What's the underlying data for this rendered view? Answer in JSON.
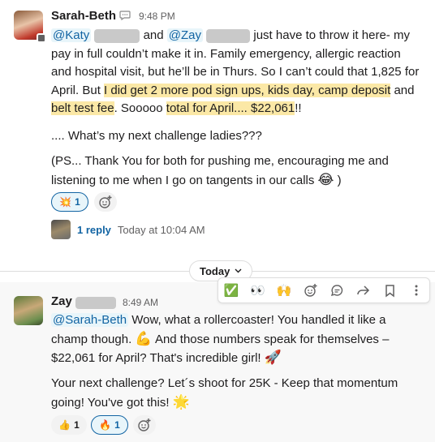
{
  "message1": {
    "author": "Sarah-Beth",
    "time": "9:48 PM",
    "mention_katy": "@Katy",
    "and": "and",
    "mention_zay": "@Zay",
    "text1": "just have to throw it here- my pay in full couldn’t make it in. Family emergency, allergic reaction and hospital visit, but he’ll be in Thurs. So I can’t could that 1,825 for April. But",
    "hl1": "I did get 2 more pod sign ups, kids day, camp deposit",
    "text2": "and",
    "hl2": "belt test fee",
    "text3": ". Sooooo",
    "hl3": "total for April.... $22,061",
    "text4": "!!",
    "para2": ".... What’s my next challenge ladies???",
    "para3": "(PS... Thank You for both for pushing me, encouraging me and listening to me when I go on tangents in our calls",
    "para3_end": ")",
    "reaction_emoji": "💥",
    "reaction_count": "1",
    "reply_count": "1 reply",
    "reply_time": "Today at 10:04 AM"
  },
  "divider": {
    "label": "Today"
  },
  "toolbar": {
    "check": "✅",
    "eyes": "👀",
    "raised_hands": "🙌"
  },
  "message2": {
    "author": "Zay",
    "time": "8:49 AM",
    "mention": "@Sarah-Beth",
    "text1": "Wow, what a rollercoaster! You handled it like a champ though.",
    "flex": "💪",
    "text2": "And those numbers speak for themselves – $22,061 for April? That's incredible girl!",
    "rocket": "🚀",
    "para2": "Your next challenge?  Let´s shoot for 25K - Keep that momentum going! You've got this!",
    "star": "🌟",
    "reaction1_emoji": "👍",
    "reaction1_count": "1",
    "reaction2_emoji": "🔥",
    "reaction2_count": "1"
  },
  "colors": {
    "link": "#1264a3",
    "highlight": "#fbe8a6",
    "mention_bg": "#e8f5fa",
    "muted": "#616061"
  }
}
